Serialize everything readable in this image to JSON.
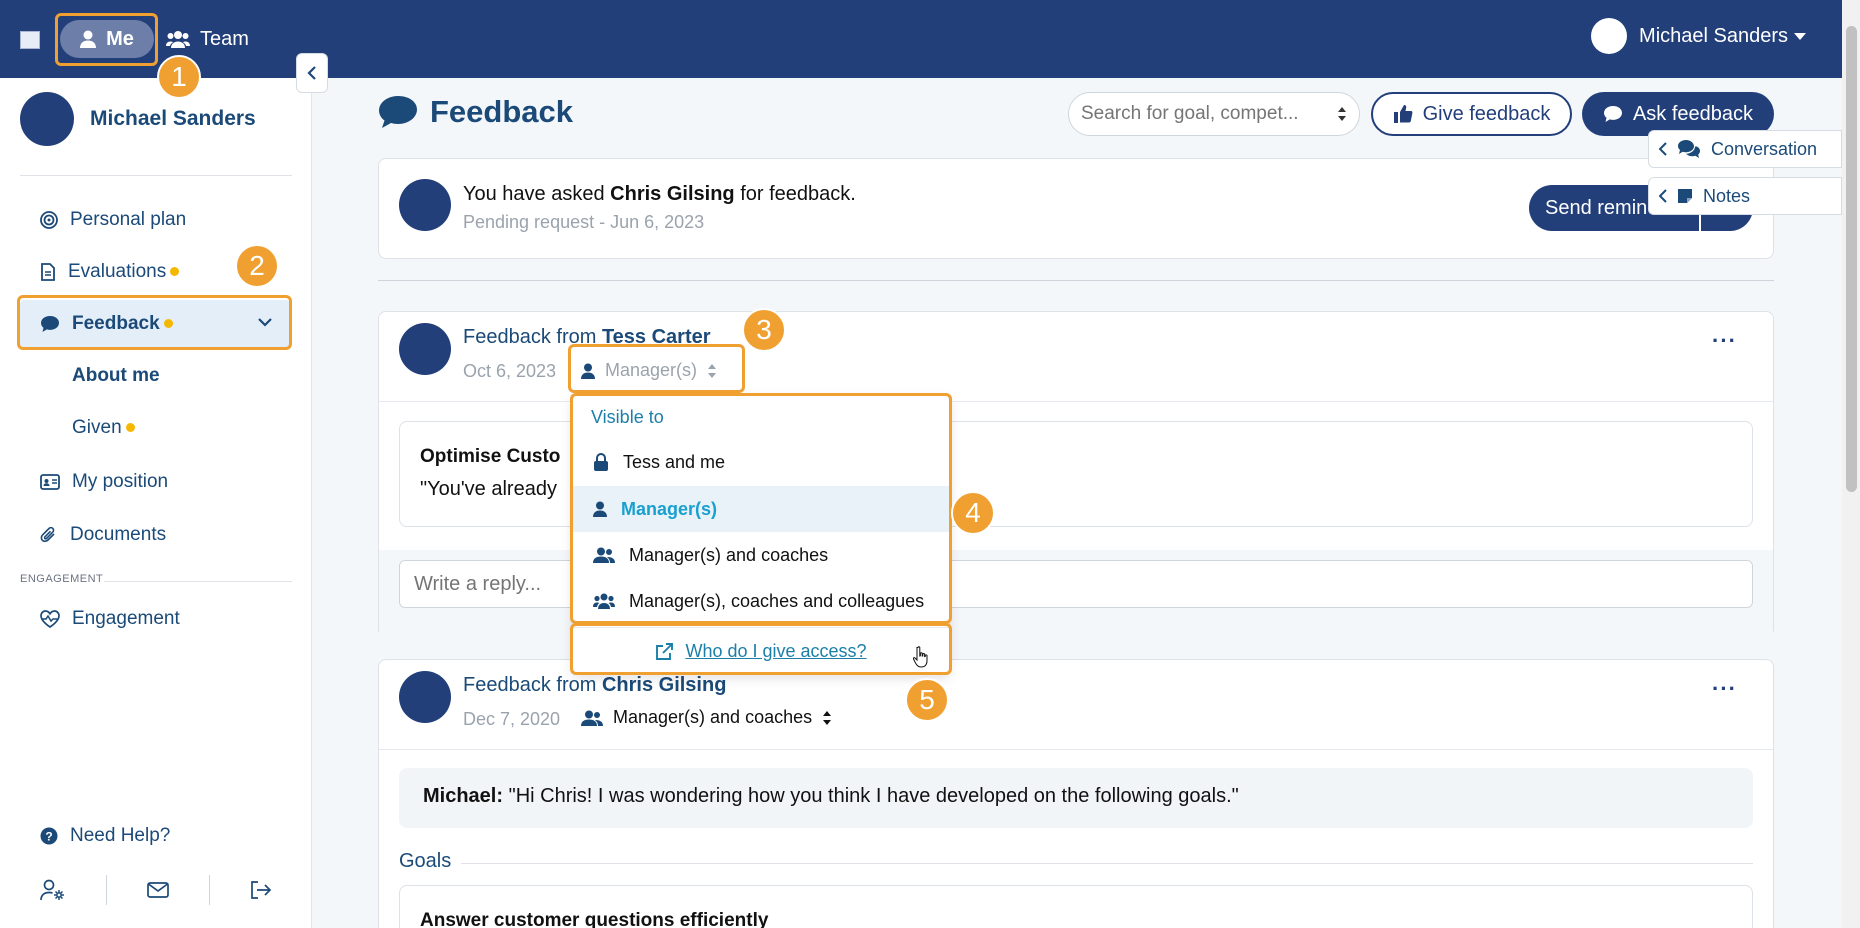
{
  "topbar": {
    "me_label": "Me",
    "team_label": "Team",
    "user_name": "Michael Sanders"
  },
  "sidebar": {
    "profile_name": "Michael Sanders",
    "items": [
      {
        "label": "Personal plan"
      },
      {
        "label": "Evaluations"
      },
      {
        "label": "Feedback"
      },
      {
        "label": "About me"
      },
      {
        "label": "Given"
      },
      {
        "label": "My position"
      },
      {
        "label": "Documents"
      }
    ],
    "section_engagement": "ENGAGEMENT",
    "engagement_label": "Engagement",
    "help_label": "Need Help?"
  },
  "header": {
    "title": "Feedback",
    "search_placeholder": "Search for goal, compet...",
    "give_feedback": "Give feedback",
    "ask_feedback": "Ask feedback"
  },
  "side_tabs": {
    "conversation": "Conversation",
    "notes": "Notes"
  },
  "request": {
    "prefix": "You have asked",
    "person": "Chris Gilsing",
    "suffix": "for feedback.",
    "status": "Pending request - Jun 6, 2023",
    "remind_label": "Send reminder"
  },
  "feedback1": {
    "title_prefix": "Feedback from",
    "from": "Tess Carter",
    "date": "Oct 6, 2023",
    "visibility": "Manager(s)",
    "comment_title": "Optimise Custo",
    "comment_text": "\"You've already",
    "reply_placeholder": "Write a reply..."
  },
  "dropdown": {
    "header": "Visible to",
    "options": [
      {
        "label": "Tess and me"
      },
      {
        "label": "Manager(s)"
      },
      {
        "label": "Manager(s) and coaches"
      },
      {
        "label": "Manager(s), coaches and colleagues"
      }
    ],
    "footer_link": "Who do I give access?"
  },
  "feedback2": {
    "title_prefix": "Feedback from",
    "from": "Chris Gilsing",
    "date": "Dec 7, 2020",
    "visibility": "Manager(s) and coaches",
    "message_author": "Michael:",
    "message_text": "\"Hi Chris! I was wondering how you think I have developed on the following goals.\"",
    "goals_label": "Goals",
    "goal_title": "Answer customer questions efficiently"
  },
  "annotations": [
    "1",
    "2",
    "3",
    "4",
    "5"
  ],
  "colors": {
    "navy": "#223f7a",
    "accent": "#f0a030",
    "dot": "#f5b800",
    "link": "#1b7fa8"
  }
}
